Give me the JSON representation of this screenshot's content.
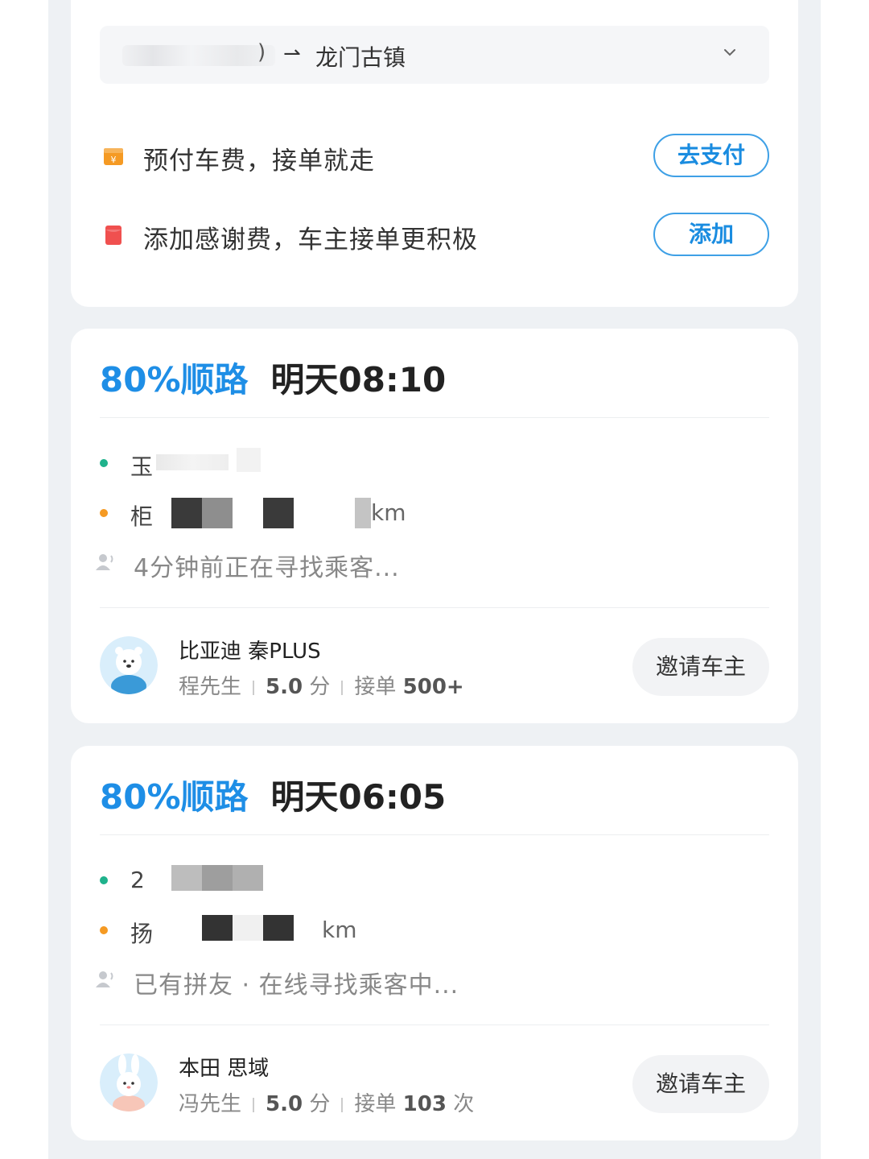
{
  "route": {
    "from_tail": ")",
    "arrow": "⇀",
    "to": "龙门古镇"
  },
  "options": [
    {
      "text": "预付车费，接单就走",
      "button": "去支付",
      "icon": "yuan-wallet-icon",
      "icon_color": "#f59a23"
    },
    {
      "text": "添加感谢费，车主接单更积极",
      "button": "添加",
      "icon": "red-envelope-icon",
      "icon_color": "#f0504f"
    }
  ],
  "trips": [
    {
      "match": "80%顺路",
      "time": "明天08:10",
      "stop_a": "玉",
      "stop_b": "柜",
      "stop_b_tail": "km",
      "status": "4分钟前正在寻找乘客...",
      "car": "比亚迪 秦PLUS",
      "driver": "程先生",
      "rating": "5.0",
      "rating_unit": "分",
      "orders_label": "接单",
      "orders": "500+",
      "orders_unit": "",
      "invite": "邀请车主"
    },
    {
      "match": "80%顺路",
      "time": "明天06:05",
      "stop_a": "2",
      "stop_b": "扬",
      "stop_b_tail": "km",
      "status": "已有拼友 · 在线寻找乘客中...",
      "car": "本田 思域",
      "driver": "冯先生",
      "rating": "5.0",
      "rating_unit": "分",
      "orders_label": "接单",
      "orders": "103",
      "orders_unit": "次",
      "invite": "邀请车主"
    }
  ],
  "colors": {
    "accent": "#1e8ee6",
    "green_dot": "#1fb28c",
    "orange_dot": "#f59a23"
  }
}
